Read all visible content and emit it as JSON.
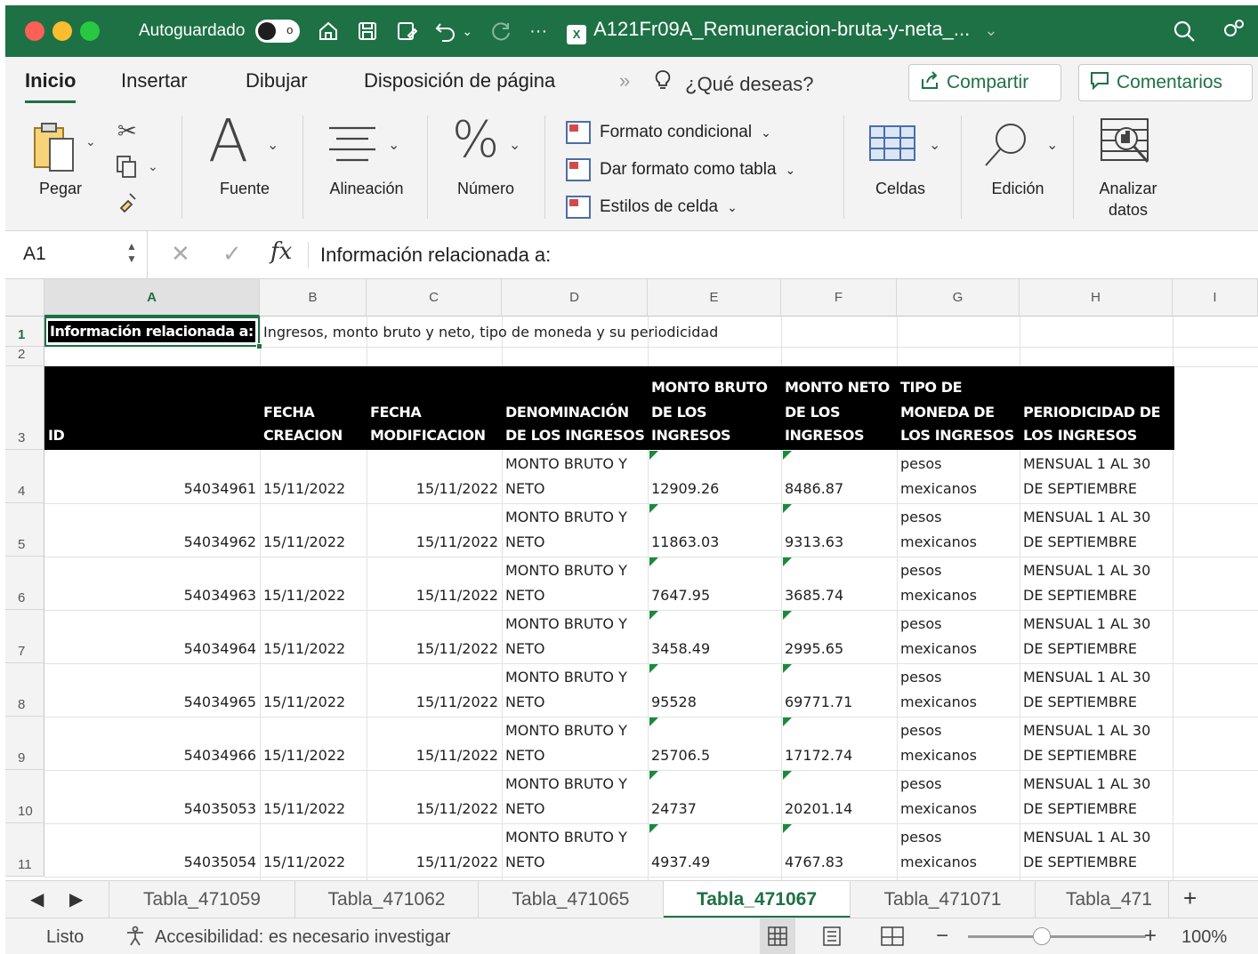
{
  "titlebar": {
    "autosave_label": "Autoguardado",
    "autosave_state": "o",
    "doc_title": "A121Fr09A_Remuneracion-bruta-y-neta_...",
    "doc_chevron": "⌄",
    "more": "···",
    "icons": [
      "home-icon",
      "save-icon",
      "save-as-icon",
      "undo-icon",
      "redo-icon",
      "search-icon",
      "share-user-icon"
    ]
  },
  "ribbon_tabs": {
    "tabs": [
      "Inicio",
      "Insertar",
      "Dibujar",
      "Disposición de página"
    ],
    "more": "»",
    "tell_me": "¿Qué deseas?",
    "share": "Compartir",
    "comments": "Comentarios"
  },
  "ribbon": {
    "paste": "Pegar",
    "font": "Fuente",
    "alignment": "Alineación",
    "number": "Número",
    "cond_format": "Formato condicional",
    "format_table": "Dar formato como tabla",
    "cell_styles": "Estilos de celda",
    "cells": "Celdas",
    "edit": "Edición",
    "analyze_1": "Analizar",
    "analyze_2": "datos"
  },
  "formula_bar": {
    "name_box": "A1",
    "formula": "Información relacionada a:"
  },
  "grid": {
    "columns": [
      "A",
      "B",
      "C",
      "D",
      "E",
      "F",
      "G",
      "H",
      "I"
    ],
    "row_numbers": [
      "1",
      "2",
      "3",
      "4",
      "5",
      "6",
      "7",
      "8",
      "9",
      "10",
      "11"
    ],
    "a1": "Información relacionada a:",
    "b1": "Ingresos, monto bruto y neto, tipo de moneda y su periodicidad",
    "headers": {
      "id": "ID",
      "created_1": "FECHA",
      "created_2": "CREACION",
      "modified_1": "FECHA",
      "modified_2": "MODIFICACION",
      "denom_1": "DENOMINACIÓN",
      "denom_2": "DE LOS INGRESOS",
      "gross_1": "MONTO BRUTO",
      "gross_2": "DE LOS",
      "gross_3": "INGRESOS",
      "net_1": "MONTO NETO",
      "net_2": "DE LOS",
      "net_3": "INGRESOS",
      "currency_1": "TIPO DE",
      "currency_2": "MONEDA DE",
      "currency_3": "LOS INGRESOS",
      "period_1": "PERIODICIDAD DE",
      "period_2": "LOS INGRESOS"
    },
    "rows": [
      {
        "id": "54034961",
        "created": "15/11/2022",
        "modified": "15/11/2022",
        "denom_1": "MONTO BRUTO Y",
        "denom_2": "NETO",
        "gross": "12909.26",
        "net": "8486.87",
        "currency_1": "pesos",
        "currency_2": "mexicanos",
        "period_1": "MENSUAL 1 AL 30",
        "period_2": "DE SEPTIEMBRE"
      },
      {
        "id": "54034962",
        "created": "15/11/2022",
        "modified": "15/11/2022",
        "denom_1": "MONTO BRUTO Y",
        "denom_2": "NETO",
        "gross": "11863.03",
        "net": "9313.63",
        "currency_1": "pesos",
        "currency_2": "mexicanos",
        "period_1": "MENSUAL 1 AL 30",
        "period_2": "DE SEPTIEMBRE"
      },
      {
        "id": "54034963",
        "created": "15/11/2022",
        "modified": "15/11/2022",
        "denom_1": "MONTO BRUTO Y",
        "denom_2": "NETO",
        "gross": "7647.95",
        "net": "3685.74",
        "currency_1": "pesos",
        "currency_2": "mexicanos",
        "period_1": "MENSUAL 1 AL 30",
        "period_2": "DE SEPTIEMBRE"
      },
      {
        "id": "54034964",
        "created": "15/11/2022",
        "modified": "15/11/2022",
        "denom_1": "MONTO BRUTO Y",
        "denom_2": "NETO",
        "gross": "3458.49",
        "net": "2995.65",
        "currency_1": "pesos",
        "currency_2": "mexicanos",
        "period_1": "MENSUAL 1 AL 30",
        "period_2": "DE SEPTIEMBRE"
      },
      {
        "id": "54034965",
        "created": "15/11/2022",
        "modified": "15/11/2022",
        "denom_1": "MONTO BRUTO Y",
        "denom_2": "NETO",
        "gross": "95528",
        "net": "69771.71",
        "currency_1": "pesos",
        "currency_2": "mexicanos",
        "period_1": "MENSUAL 1 AL 30",
        "period_2": "DE SEPTIEMBRE"
      },
      {
        "id": "54034966",
        "created": "15/11/2022",
        "modified": "15/11/2022",
        "denom_1": "MONTO BRUTO Y",
        "denom_2": "NETO",
        "gross": "25706.5",
        "net": "17172.74",
        "currency_1": "pesos",
        "currency_2": "mexicanos",
        "period_1": "MENSUAL 1 AL 30",
        "period_2": "DE SEPTIEMBRE"
      },
      {
        "id": "54035053",
        "created": "15/11/2022",
        "modified": "15/11/2022",
        "denom_1": "MONTO BRUTO Y",
        "denom_2": "NETO",
        "gross": "24737",
        "net": "20201.14",
        "currency_1": "pesos",
        "currency_2": "mexicanos",
        "period_1": "MENSUAL 1 AL 30",
        "period_2": "DE SEPTIEMBRE"
      },
      {
        "id": "54035054",
        "created": "15/11/2022",
        "modified": "15/11/2022",
        "denom_1": "MONTO BRUTO Y",
        "denom_2": "NETO",
        "gross": "4937.49",
        "net": "4767.83",
        "currency_1": "pesos",
        "currency_2": "mexicanos",
        "period_1": "MENSUAL 1 AL 30",
        "period_2": "DE SEPTIEMBRE"
      }
    ]
  },
  "sheet_tabs": {
    "tabs": [
      "Tabla_471059",
      "Tabla_471062",
      "Tabla_471065",
      "Tabla_471067",
      "Tabla_471071",
      "Tabla_471"
    ],
    "active": "Tabla_471067",
    "add": "+"
  },
  "statusbar": {
    "ready": "Listo",
    "accessibility": "Accesibilidad: es necesario investigar",
    "zoom": "100%",
    "zoom_minus": "−",
    "zoom_plus": "+"
  },
  "colors": {
    "accent": "#1e7145",
    "header_fill": "#000000",
    "error_triangle": "#1a8a3a"
  }
}
